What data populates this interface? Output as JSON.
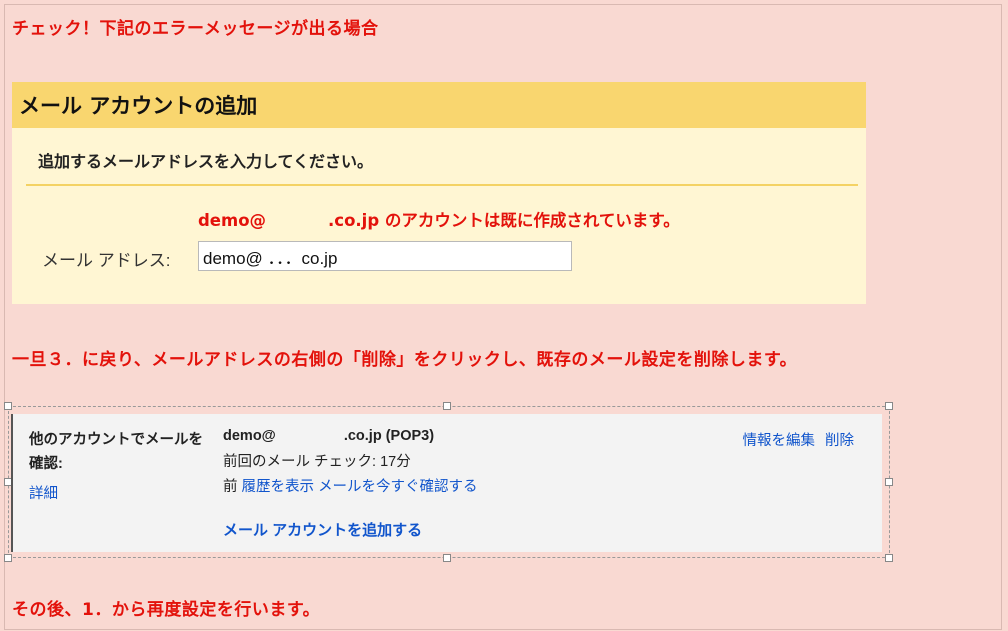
{
  "notes": {
    "check": "チェック！下記のエラーメッセージが出る場合",
    "step": "一旦３．に戻り、メールアドレスの右側の「削除」をクリックし、既存のメール設定を削除します。",
    "after": "その後、1．から再度設定を行います。"
  },
  "add_account_panel": {
    "title": "メール アカウントの追加",
    "instruction": "追加するメールアドレスを入力してください。",
    "error_prefix": "demo@",
    "error_suffix": ".co.jp のアカウントは既に作成されています。",
    "email_label": "メール アドレス:",
    "email_value": "demo@ ．．．co.jp"
  },
  "account_settings": {
    "label": "他のアカウントでメールを確認:",
    "detail_link": "詳細",
    "email_prefix": "demo@",
    "email_suffix": ".co.jp (POP3)",
    "last_check": "前回のメール チェック: 17分",
    "links_prefix": "前",
    "history_link": "履歴を表示",
    "check_now_link": "メールを今すぐ確認する",
    "edit_link": "情報を編集",
    "delete_link": "削除",
    "add_account_link": "メール アカウントを追加する"
  },
  "colors": {
    "background": "#f9d9d2",
    "note_red": "#e3120b",
    "panel_header": "#f9d66f",
    "panel_body": "#fff6d3",
    "link_blue": "#1155cc"
  }
}
